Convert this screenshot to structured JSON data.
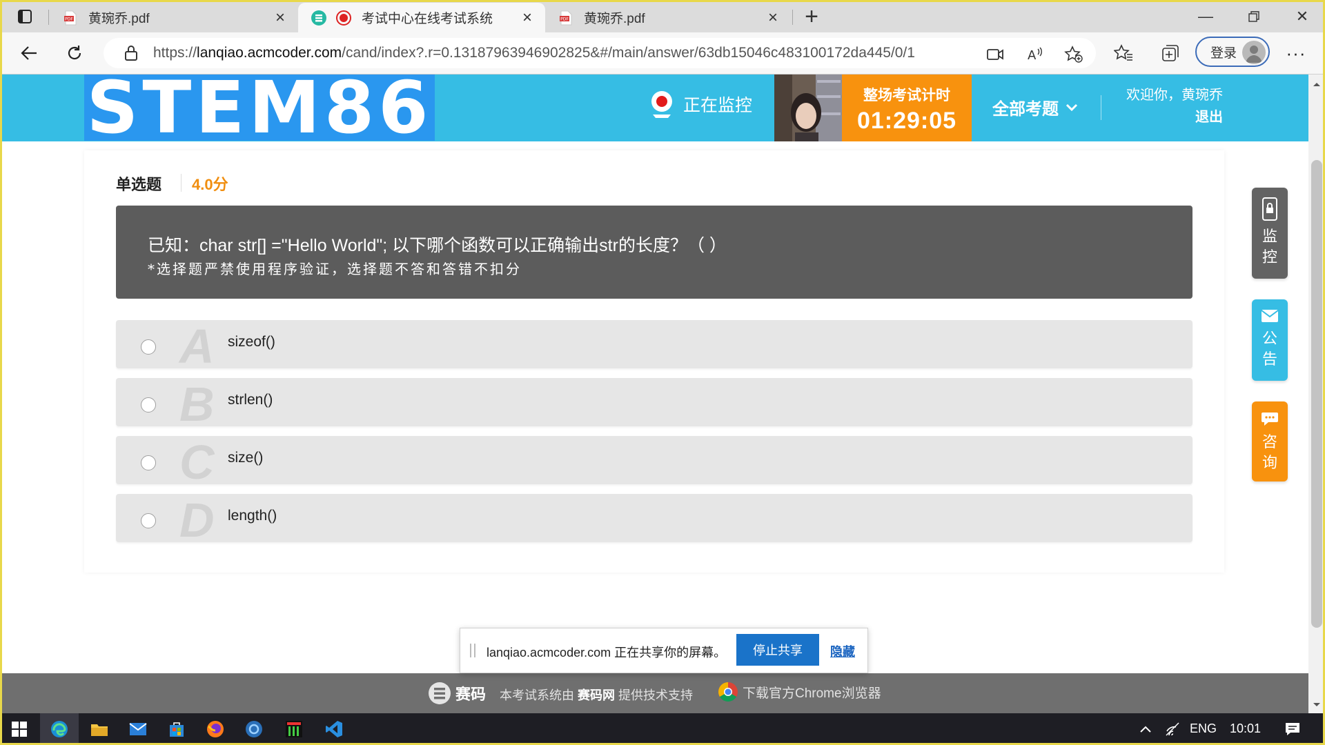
{
  "browser": {
    "tabs": [
      {
        "title": "黄琬乔.pdf",
        "icon": "pdf-icon",
        "active": false
      },
      {
        "title": "考试中心在线考试系统",
        "icon": "site-icon",
        "active": true
      },
      {
        "title": "黄琬乔.pdf",
        "icon": "pdf-icon",
        "active": false
      }
    ],
    "url_prefix": "https://",
    "url_domain": "lanqiao.acmcoder.com",
    "url_rest": "/cand/index?.r=0.13187963946902825&#/main/answer/63db15046c483100172da445/0/1",
    "login_label": "登录"
  },
  "header": {
    "logo_text": "STEM86",
    "monitoring_label": "正在监控",
    "timer_label": "整场考试计时",
    "timer_value": "01:29:05",
    "all_questions_label": "全部考题",
    "welcome_text": "欢迎你，黄琬乔",
    "logout_label": "退出"
  },
  "question": {
    "type_label": "单选题",
    "score_label": "4.0分",
    "text": "已知：char str[] =\"Hello World\"; 以下哪个函数可以正确输出str的长度？（    ）",
    "note": "*选择题严禁使用程序验证，选择题不答和答错不扣分",
    "options": [
      {
        "letter": "A",
        "text": "sizeof()"
      },
      {
        "letter": "B",
        "text": "strlen()"
      },
      {
        "letter": "C",
        "text": "size()"
      },
      {
        "letter": "D",
        "text": "length()"
      }
    ]
  },
  "side_buttons": [
    {
      "chars": [
        "监",
        "控"
      ],
      "icon": "lock-phone-icon",
      "color": "#636363"
    },
    {
      "chars": [
        "公",
        "告"
      ],
      "icon": "mail-icon",
      "color": "#36bde4"
    },
    {
      "chars": [
        "咨",
        "询"
      ],
      "icon": "chat-icon",
      "color": "#f8920e"
    }
  ],
  "footer": {
    "brand": "赛码",
    "tech_prefix": "本考试系统由",
    "tech_brand": "赛码网",
    "tech_suffix": "提供技术支持",
    "chrome_link": "下载官方Chrome浏览器"
  },
  "share_bar": {
    "message": "lanqiao.acmcoder.com 正在共享你的屏幕。",
    "stop_label": "停止共享",
    "hide_label": "隐藏"
  },
  "taskbar": {
    "language": "ENG",
    "time": "10:01"
  },
  "colors": {
    "header_bg": "#36bde4",
    "logo_bg": "#2a97ef",
    "timer_bg": "#f8920e",
    "score": "#f08e10",
    "stem_bg": "#5c5c5c",
    "option_bg": "#e6e6e6"
  }
}
